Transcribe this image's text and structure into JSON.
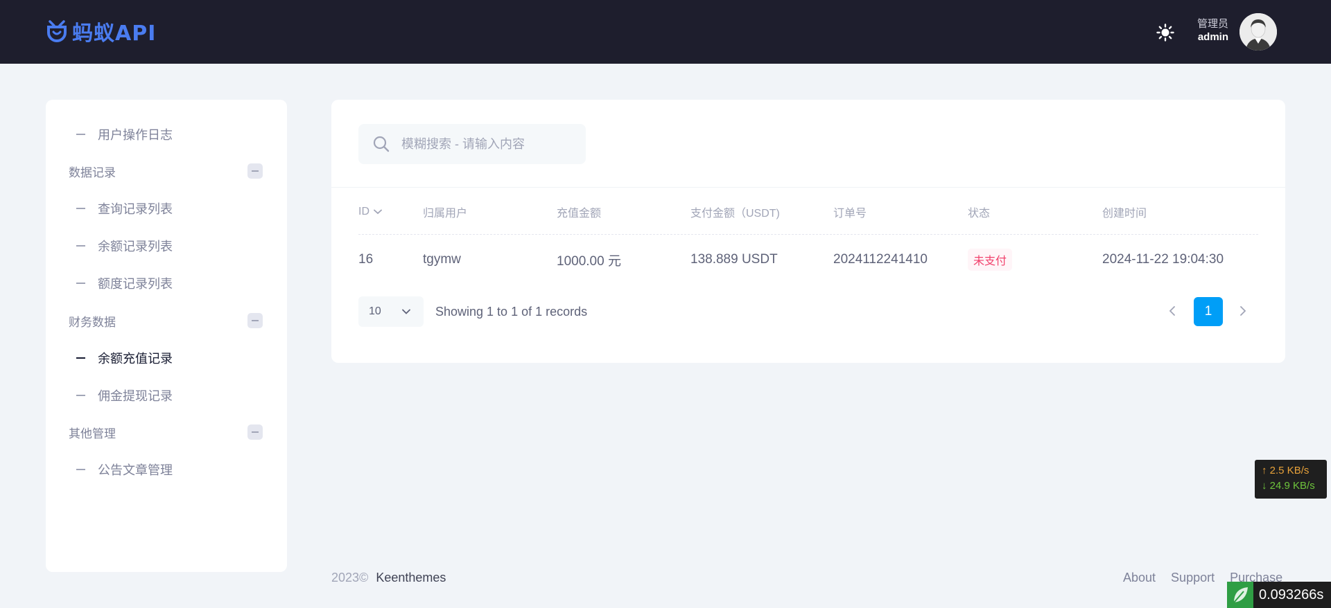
{
  "header": {
    "brand": "蚂蚁API",
    "user_role": "管理员",
    "user_name": "admin"
  },
  "sidebar": {
    "items": [
      {
        "type": "item",
        "label": "用户操作日志"
      },
      {
        "type": "section",
        "label": "数据记录"
      },
      {
        "type": "item",
        "label": "查询记录列表"
      },
      {
        "type": "item",
        "label": "余额记录列表"
      },
      {
        "type": "item",
        "label": "额度记录列表"
      },
      {
        "type": "section",
        "label": "财务数据"
      },
      {
        "type": "item",
        "label": "余额充值记录",
        "active": true
      },
      {
        "type": "item",
        "label": "佣金提现记录"
      },
      {
        "type": "section",
        "label": "其他管理"
      },
      {
        "type": "item",
        "label": "公告文章管理"
      }
    ]
  },
  "search": {
    "placeholder": "模糊搜索 - 请输入内容",
    "value": ""
  },
  "table": {
    "columns": [
      "ID",
      "归属用户",
      "充值金额",
      "支付金额（USDT)",
      "订单号",
      "状态",
      "创建时间"
    ],
    "rows": [
      {
        "id": "16",
        "user": "tgymw",
        "amount": "1000.00 元",
        "paid": "138.889 USDT",
        "order_no": "2024112241410",
        "status": "未支付",
        "created": "2024-11-22 19:04:30"
      }
    ]
  },
  "pagination": {
    "page_size": "10",
    "info": "Showing 1 to 1 of 1 records",
    "current_page": "1"
  },
  "footer": {
    "year": "2023©",
    "brand": "Keenthemes",
    "links": [
      "About",
      "Support",
      "Purchase"
    ]
  },
  "overlays": {
    "upload_speed": "↑ 2.5 KB/s",
    "download_speed": "↓ 24.9 KB/s",
    "timer": "0.093266s"
  },
  "colors": {
    "header_bg": "#1e1e2d",
    "brand_blue": "#4a7cf0",
    "primary": "#009ef7",
    "danger": "#f1416c",
    "page_bg": "#f1f4f8"
  }
}
